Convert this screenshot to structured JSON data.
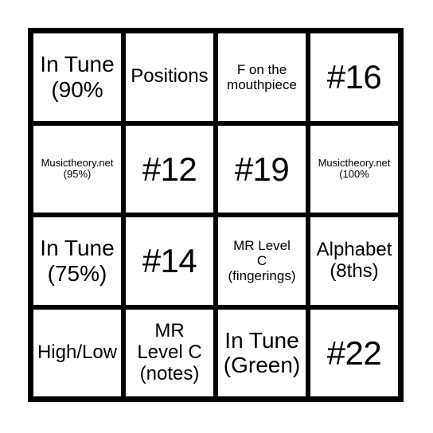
{
  "card": {
    "rows": 4,
    "columns": 4,
    "border_color": "#000000",
    "cell_background": "#ffffff",
    "text_color": "#000000",
    "cells": [
      {
        "text": "In Tune\n(90%",
        "size": "sz-lg"
      },
      {
        "text": "Positions",
        "size": "sz-md"
      },
      {
        "text": "F on the\nmouthpiece",
        "size": "sz-sm"
      },
      {
        "text": "#16",
        "size": "sz-xl"
      },
      {
        "text": "Musictheory.net\n(95%)",
        "size": "sz-xs"
      },
      {
        "text": "#12",
        "size": "sz-xl"
      },
      {
        "text": "#19",
        "size": "sz-xl"
      },
      {
        "text": "Musictheory.net\n(100%",
        "size": "sz-xs"
      },
      {
        "text": "In Tune\n(75%)",
        "size": "sz-lg"
      },
      {
        "text": "#14",
        "size": "sz-xl"
      },
      {
        "text": "MR Level\nC\n(fingerings)",
        "size": "sz-sm"
      },
      {
        "text": "Alphabet\n(8ths)",
        "size": "sz-md"
      },
      {
        "text": "High/Low",
        "size": "sz-md"
      },
      {
        "text": "MR\nLevel C\n(notes)",
        "size": "sz-md"
      },
      {
        "text": "In Tune\n(Green)",
        "size": "sz-lg"
      },
      {
        "text": "#22",
        "size": "sz-xl"
      }
    ]
  }
}
